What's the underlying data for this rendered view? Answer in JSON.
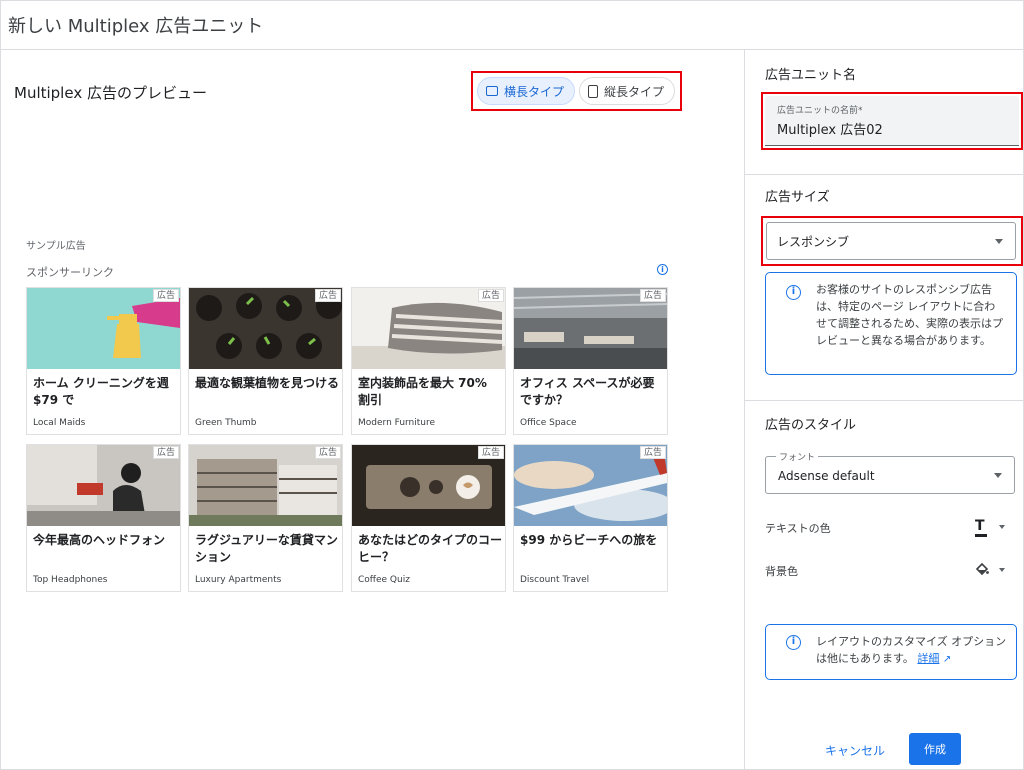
{
  "header": {
    "title": "新しい Multiplex 広告ユニット"
  },
  "preview": {
    "title": "Multiplex 広告のプレビュー",
    "toggle": {
      "horizontal": "横長タイプ",
      "vertical": "縦長タイプ",
      "selected": "horizontal"
    },
    "sample_label": "サンプル広告",
    "sponsored_label": "スポンサーリンク",
    "ad_badge": "広告",
    "cards": [
      {
        "title": "ホーム クリーニングを週 $79 で",
        "source": "Local Maids",
        "image": "cleaning-spray"
      },
      {
        "title": "最適な観葉植物を見つける",
        "source": "Green Thumb",
        "image": "seedlings"
      },
      {
        "title": "室内装飾品を最大 70% 割引",
        "source": "Modern Furniture",
        "image": "pillow"
      },
      {
        "title": "オフィス スペースが必要ですか？",
        "source": "Office Space",
        "image": "office"
      },
      {
        "title": "今年最高のヘッドフォン",
        "source": "Top Headphones",
        "image": "street-headphones"
      },
      {
        "title": "ラグジュアリーな賃貸マンション",
        "source": "Luxury Apartments",
        "image": "apartments"
      },
      {
        "title": "あなたはどのタイプのコーヒー？",
        "source": "Coffee Quiz",
        "image": "coffee"
      },
      {
        "title": "$99 からビーチへの旅を",
        "source": "Discount Travel",
        "image": "airplane-wing"
      }
    ]
  },
  "sidebar": {
    "unit_name_heading": "広告ユニット名",
    "unit_name_field_label": "広告ユニットの名前*",
    "unit_name_value": "Multiplex 広告02",
    "size_heading": "広告サイズ",
    "size_value": "レスポンシブ",
    "size_info": "お客様のサイトのレスポンシブ広告は、特定のページ レイアウトに合わせて調整されるため、実際の表示はプレビューと異なる場合があります。",
    "style_heading": "広告のスタイル",
    "font_label": "フォント",
    "font_value": "Adsense default",
    "text_color_label": "テキストの色",
    "text_color_icon": "T",
    "bg_color_label": "背景色",
    "layout_info": "レイアウトのカスタマイズ オプションは他にもあります。",
    "layout_info_link": "詳細",
    "cancel": "キャンセル",
    "create": "作成"
  },
  "colors": {
    "accent": "#1a73e8",
    "highlight": "#e8000b"
  }
}
